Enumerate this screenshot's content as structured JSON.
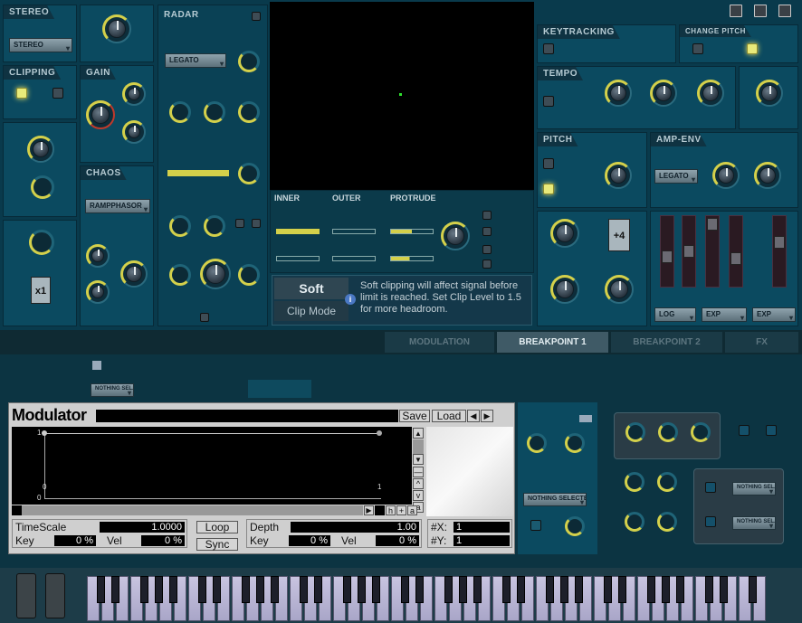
{
  "stereo": {
    "title": "STEREO",
    "mode": "STEREO"
  },
  "clipping": {
    "title": "CLIPPING"
  },
  "gain": {
    "title": "GAIN"
  },
  "chaos": {
    "title": "CHAOS",
    "mode": "RAMPPHASOR"
  },
  "multiplier": "x1",
  "radar": {
    "title": "RADAR",
    "mode": "LEGATO"
  },
  "inner_outer": {
    "inner": "INNER",
    "outer": "OUTER",
    "protrude": "PROTRUDE"
  },
  "clip_mode": {
    "value": "Soft",
    "label": "Clip Mode",
    "info_icon": "i",
    "tooltip": "Soft clipping will affect signal before limit is reached. Set Clip Level to 1.5 for more headroom."
  },
  "keytracking": {
    "title": "KEYTRACKING",
    "change_pitch": "CHANGE PITCH"
  },
  "tempo": {
    "title": "TEMPO"
  },
  "pitch": {
    "title": "PITCH",
    "transpose": "+4"
  },
  "amp_env": {
    "title": "AMP-ENV",
    "mode": "LEGATO",
    "curves": [
      "LOG",
      "EXP",
      "EXP"
    ]
  },
  "tabs": [
    "MODULATION",
    "BREAKPOINT 1",
    "BREAKPOINT 2",
    "FX"
  ],
  "active_tab": "BREAKPOINT 1",
  "nothing_selected_small": "NOTHING SEL...",
  "nothing_selected": "NOTHING SELECTED",
  "modulator": {
    "title": "Modulator",
    "save": "Save",
    "load": "Load",
    "prev": "◀",
    "next": "▶",
    "side_buttons": [
      "▲",
      "▼",
      "—",
      "^",
      "v",
      "a"
    ],
    "bottom_buttons": [
      "▶",
      "h",
      "+",
      "a"
    ],
    "graph": {
      "x_start": "0",
      "x_end": "1",
      "y_top": "1",
      "y_bottom": "0"
    },
    "timescale_label": "TimeScale",
    "timescale": "1.0000",
    "key_label": "Key",
    "key": "0 %",
    "vel_label": "Vel",
    "vel": "0 %",
    "loop": "Loop",
    "sync": "Sync",
    "depth_label": "Depth",
    "depth": "1.00",
    "key2_label": "Key",
    "key2": "0 %",
    "vel2_label": "Vel",
    "vel2": "0 %",
    "x_label": "#X:",
    "x_val": "1",
    "y_label": "#Y:",
    "y_val": "1"
  },
  "accent": "#d4d04a",
  "panel_bg": "#0b4a60"
}
